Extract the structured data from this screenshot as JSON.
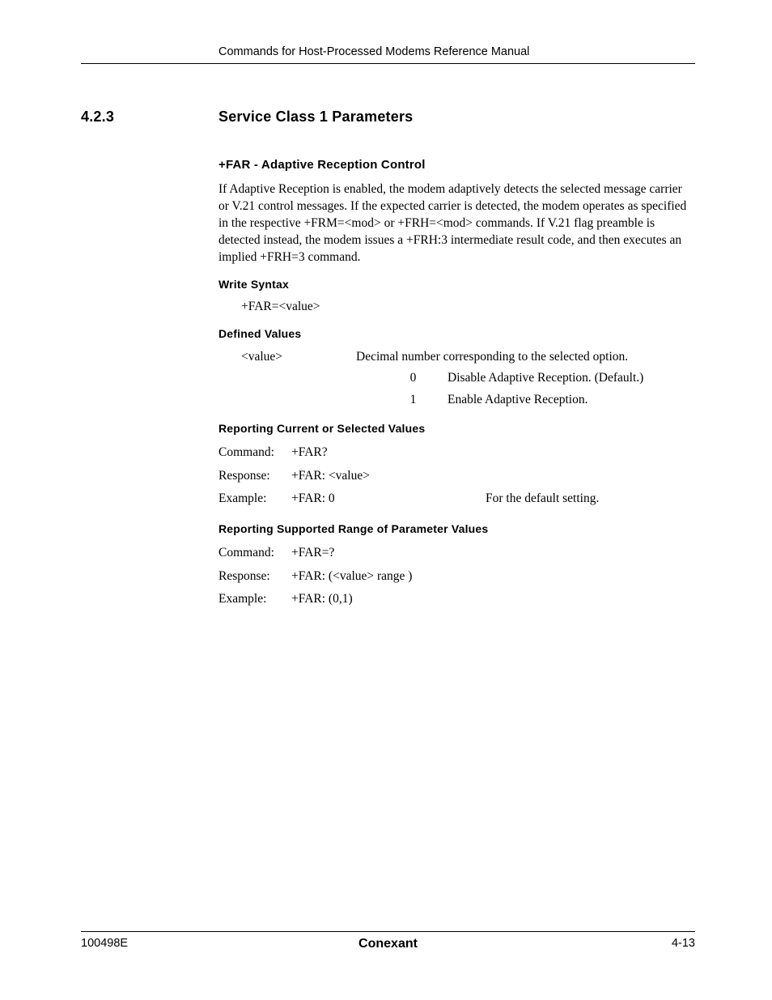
{
  "header": {
    "running_title": "Commands for Host-Processed Modems Reference Manual"
  },
  "section": {
    "number": "4.2.3",
    "title": "Service Class 1 Parameters"
  },
  "subsection1": {
    "heading": "+FAR - Adaptive Reception Control",
    "paragraph": " If Adaptive Reception is enabled, the modem adaptively detects the selected message carrier or V.21 control messages. If the expected carrier is detected, the modem operates as specified in the respective +FRM=<mod> or +FRH=<mod> commands. If V.21 flag preamble is detected instead, the modem issues a +FRH:3 intermediate result code, and then executes an implied +FRH=3 command."
  },
  "write_syntax": {
    "heading": "Write Syntax",
    "value": "+FAR=<value>"
  },
  "defined_values": {
    "heading": "Defined Values",
    "label": "<value>",
    "desc": "Decimal number corresponding to the selected option.",
    "options": [
      {
        "num": "0",
        "text": "Disable Adaptive Reception. (Default.)"
      },
      {
        "num": "1",
        "text": "Enable Adaptive Reception."
      }
    ]
  },
  "reporting_current": {
    "heading": "Reporting Current or Selected Values",
    "rows": [
      {
        "label": "Command:",
        "value": "+FAR?",
        "note": ""
      },
      {
        "label": "Response:",
        "value": "+FAR: <value>",
        "note": ""
      },
      {
        "label": "Example:",
        "value": "+FAR: 0",
        "note": "For the default setting."
      }
    ]
  },
  "reporting_range": {
    "heading": "Reporting Supported Range of Parameter Values",
    "rows": [
      {
        "label": "Command:",
        "value": "+FAR=?",
        "note": ""
      },
      {
        "label": "Response:",
        "value": "+FAR: (<value> range )",
        "note": ""
      },
      {
        "label": "Example:",
        "value": "+FAR: (0,1)",
        "note": ""
      }
    ]
  },
  "footer": {
    "left": "100498E",
    "center": "Conexant",
    "right": "4-13"
  }
}
